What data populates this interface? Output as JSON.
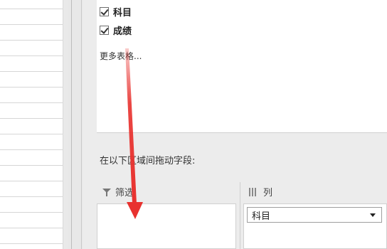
{
  "field_list": {
    "items": [
      {
        "label": "科目",
        "checked": true
      },
      {
        "label": "成绩",
        "checked": true
      }
    ],
    "more_tables": "更多表格..."
  },
  "drag_instruction": "在以下区域间拖动字段:",
  "areas": {
    "filter": {
      "label": "筛选"
    },
    "columns": {
      "label": "列",
      "fields": [
        {
          "label": "科目"
        }
      ]
    }
  },
  "colors": {
    "arrow": "#e8322f"
  }
}
